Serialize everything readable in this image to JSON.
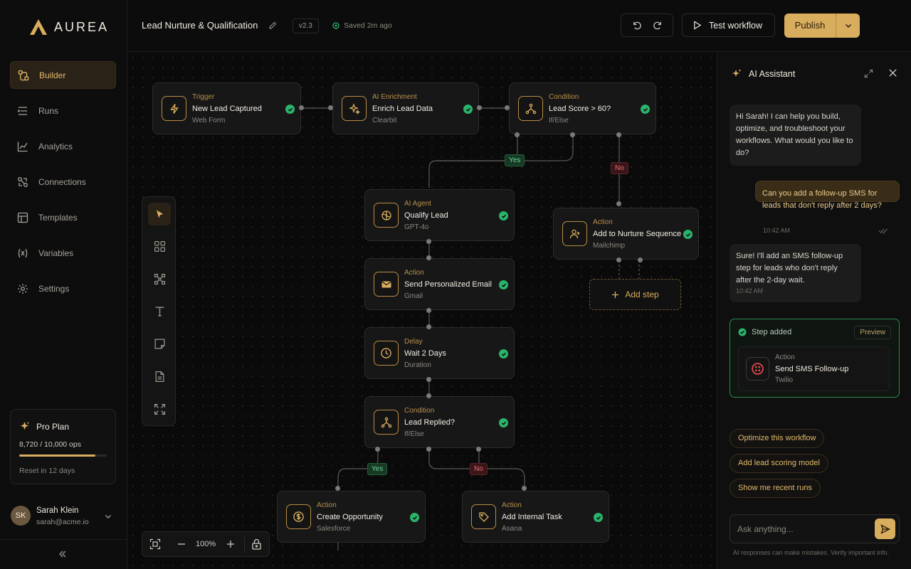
{
  "brand": {
    "name": "AUREA"
  },
  "sidebar": {
    "items": [
      {
        "label": "Builder",
        "icon": "builder-icon"
      },
      {
        "label": "Runs",
        "icon": "runs-icon"
      },
      {
        "label": "Analytics",
        "icon": "analytics-icon"
      },
      {
        "label": "Connections",
        "icon": "connections-icon"
      },
      {
        "label": "Templates",
        "icon": "templates-icon"
      },
      {
        "label": "Variables",
        "icon": "variables-icon"
      },
      {
        "label": "Settings",
        "icon": "gear-icon"
      }
    ],
    "active": "Builder",
    "plan": {
      "name": "Pro Plan",
      "ops": "8,720 / 10,000 ops",
      "usage_fraction": 0.872,
      "reset": "Reset in 12 days"
    },
    "user": {
      "initials": "SK",
      "name": "Sarah Klein",
      "email": "sarah@acme.io"
    }
  },
  "header": {
    "title": "Lead Nurture & Qualification",
    "version": "v2.3",
    "saved": "Saved 2m ago",
    "test_label": "Test workflow",
    "publish_label": "Publish"
  },
  "nodes": {
    "trigger": {
      "type": "Trigger",
      "title": "New Lead Captured",
      "sub": "Web Form"
    },
    "enrich": {
      "type": "AI Enrichment",
      "title": "Enrich Lead Data",
      "sub": "Clearbit"
    },
    "condition1": {
      "type": "Condition",
      "title": "Lead Score > 60?",
      "sub": "If/Else"
    },
    "agent": {
      "type": "AI Agent",
      "title": "Qualify Lead",
      "sub": "GPT-4o"
    },
    "nurture": {
      "type": "Action",
      "title": "Add to Nurture Sequence",
      "sub": "Mailchimp"
    },
    "email": {
      "type": "Action",
      "title": "Send Personalized Email",
      "sub": "Gmail"
    },
    "delay": {
      "type": "Delay",
      "title": "Wait 2 Days",
      "sub": "Duration"
    },
    "condition2": {
      "type": "Condition",
      "title": "Lead Replied?",
      "sub": "If/Else"
    },
    "opportunity": {
      "type": "Action",
      "title": "Create Opportunity",
      "sub": "Salesforce"
    },
    "task": {
      "type": "Action",
      "title": "Add Internal Task",
      "sub": "Asana"
    }
  },
  "branches": {
    "yes": "Yes",
    "no": "No"
  },
  "add_step": "Add step",
  "zoom": "100%",
  "assistant": {
    "title": "AI Assistant",
    "messages": [
      {
        "role": "ai",
        "text": "Hi Sarah! I can help you build, optimize, and troubleshoot your workflows. What would you like to do?"
      },
      {
        "role": "user",
        "text": "Can you add a follow-up SMS for leads that don't reply after 2 days?",
        "time": "10:42 AM"
      },
      {
        "role": "ai",
        "text": "Sure! I'll add an SMS follow-up step for leads who don't reply after the 2-day wait.",
        "time": "10:42 AM"
      }
    ],
    "step_card": {
      "status": "Step added",
      "preview": "Preview",
      "type": "Action",
      "title": "Send SMS Follow-up",
      "sub": "Twilio"
    },
    "suggestions": [
      "Optimize this workflow",
      "Add lead scoring model",
      "Show me recent runs"
    ],
    "input_placeholder": "Ask anything...",
    "disclaimer": "AI responses can make mistakes. Verify important info."
  },
  "colors": {
    "accent": "#d9ad5e",
    "success": "#2bb36b",
    "danger": "#ec6d76"
  }
}
